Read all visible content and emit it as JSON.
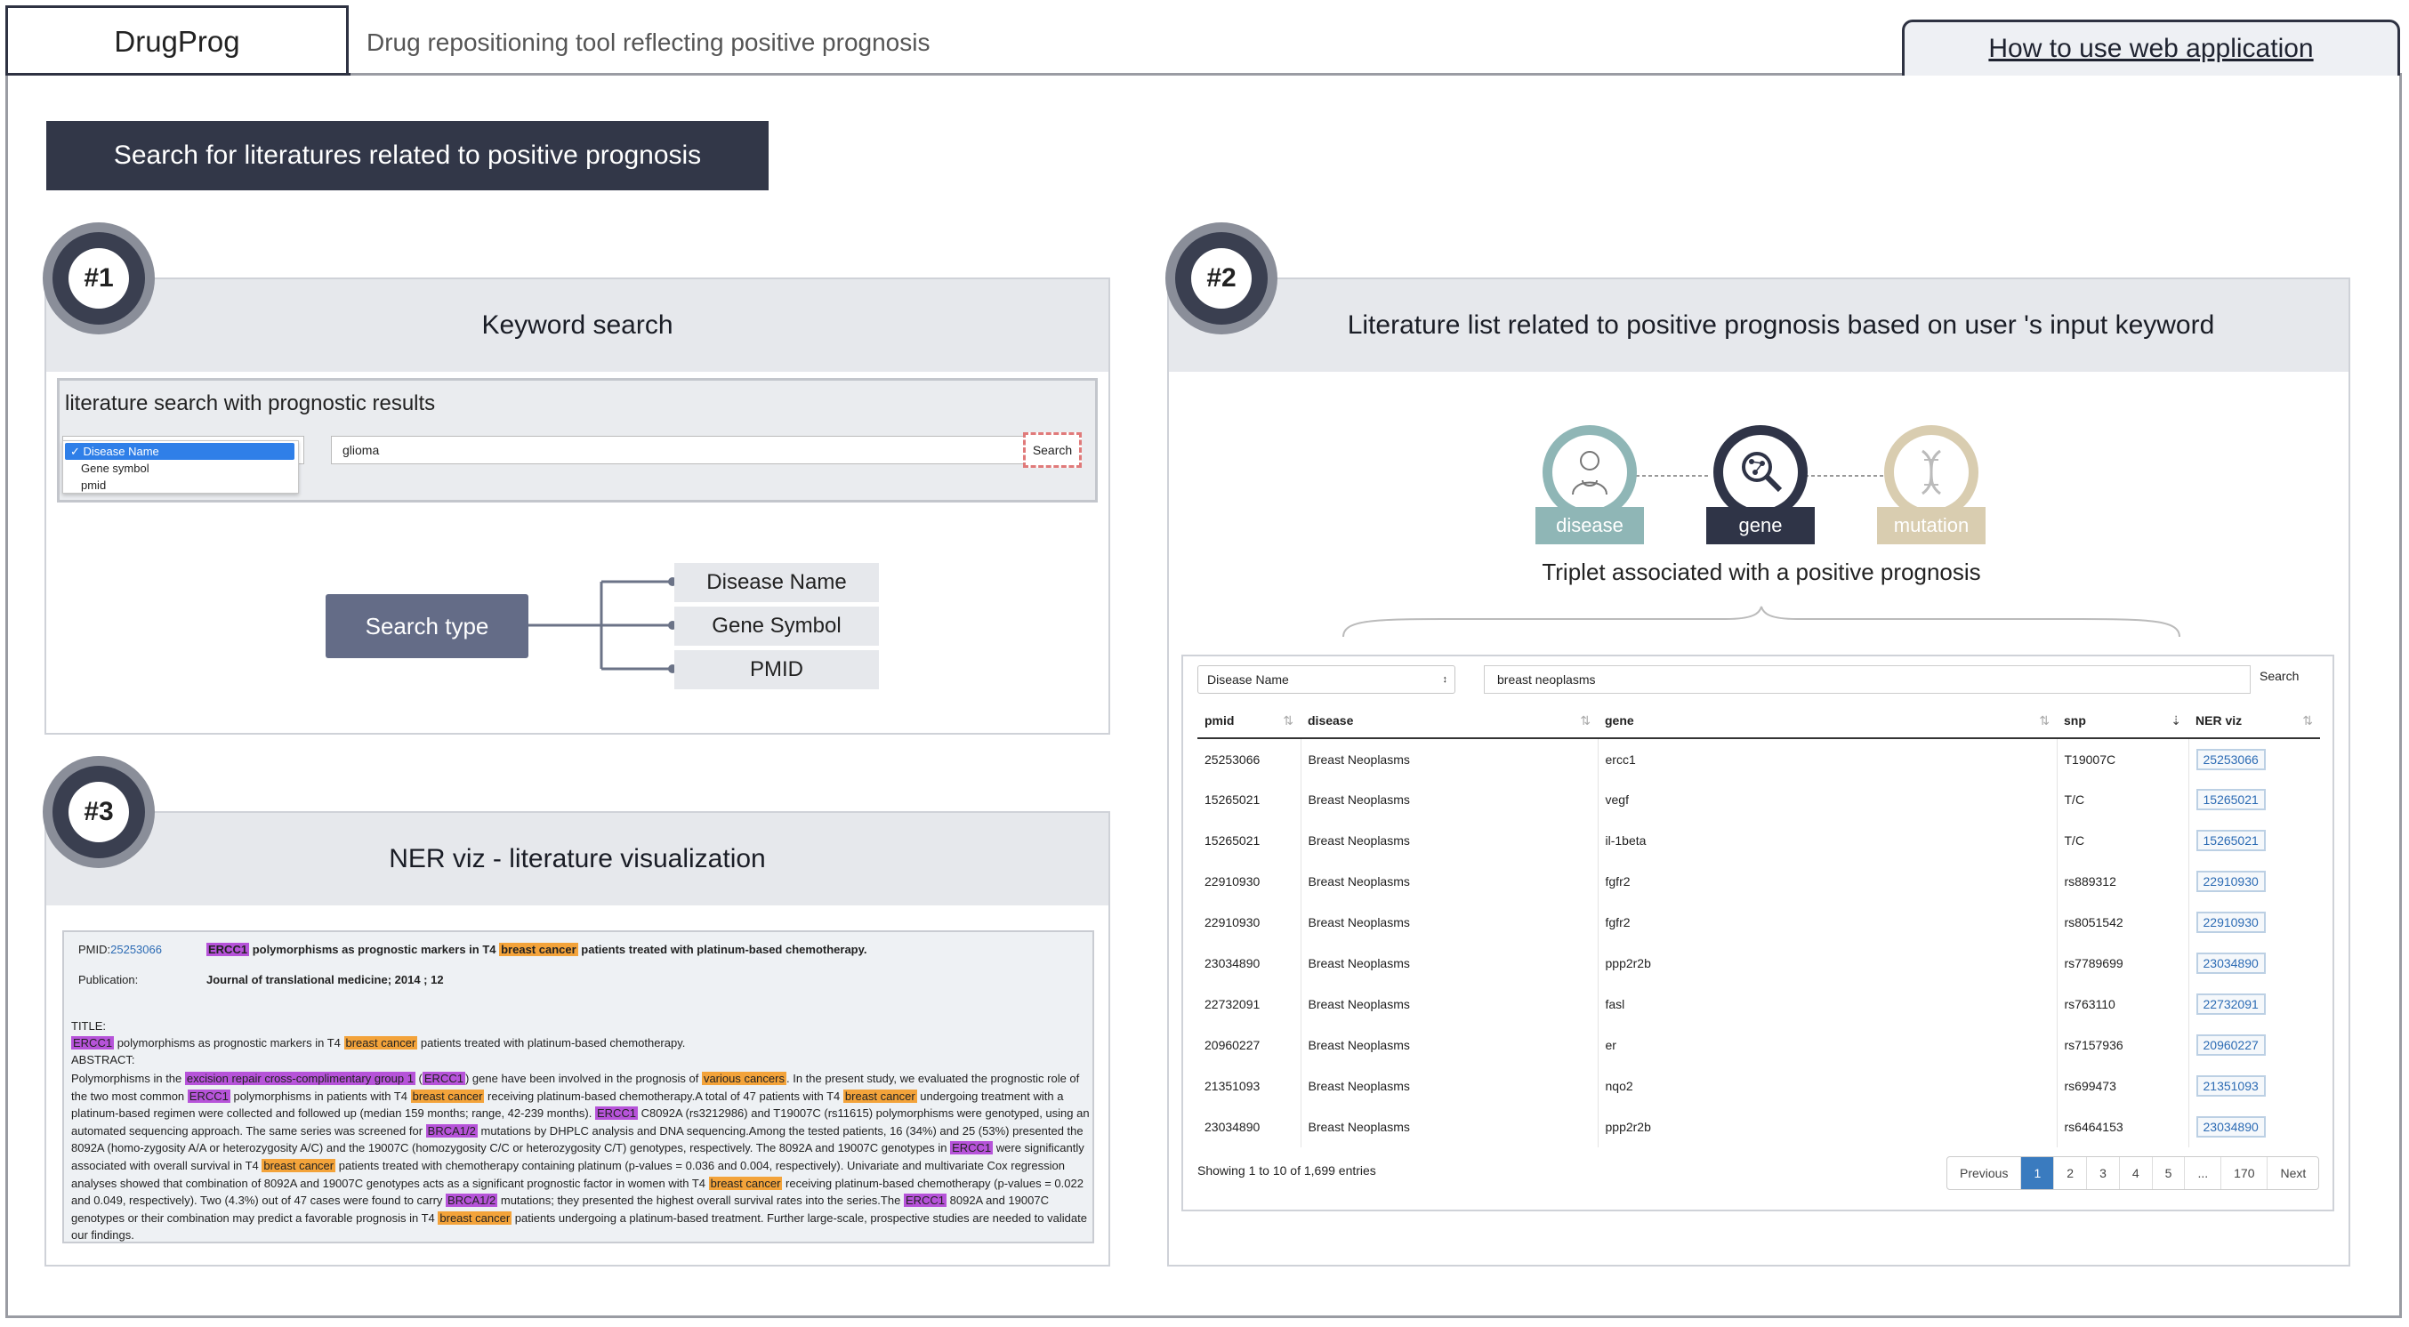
{
  "header": {
    "brand": "DrugProg",
    "tagline": "Drug repositioning tool reflecting positive prognosis",
    "howto_link": "How to use web application"
  },
  "banner": "Search for literatures related to positive prognosis",
  "panel1": {
    "badge": "#1",
    "title": "Keyword search",
    "box_title": "literature search with prognostic results",
    "dropdown_options": [
      "Disease Name",
      "Gene symbol",
      "pmid"
    ],
    "selected_check": "✓",
    "keyword": "glioma",
    "search_label": "Search",
    "search_type_label": "Search type",
    "search_types": [
      "Disease Name",
      "Gene Symbol",
      "PMID"
    ]
  },
  "panel2": {
    "badge": "#2",
    "title": "Literature list related to positive prognosis based on user 's input keyword",
    "triplet": [
      "disease",
      "gene",
      "mutation"
    ],
    "triplet_caption": "Triplet associated with a positive prognosis",
    "filter_select": "Disease Name",
    "filter_value": "breast neoplasms",
    "filter_search": "Search",
    "columns": [
      "pmid",
      "disease",
      "gene",
      "snp",
      "NER viz"
    ],
    "rows": [
      {
        "pmid": "25253066",
        "disease": "Breast Neoplasms",
        "gene": "ercc1",
        "snp": "T19007C",
        "ner": "25253066"
      },
      {
        "pmid": "15265021",
        "disease": "Breast Neoplasms",
        "gene": "vegf",
        "snp": "T/C",
        "ner": "15265021"
      },
      {
        "pmid": "15265021",
        "disease": "Breast Neoplasms",
        "gene": "il-1beta",
        "snp": "T/C",
        "ner": "15265021"
      },
      {
        "pmid": "22910930",
        "disease": "Breast Neoplasms",
        "gene": "fgfr2",
        "snp": "rs889312",
        "ner": "22910930"
      },
      {
        "pmid": "22910930",
        "disease": "Breast Neoplasms",
        "gene": "fgfr2",
        "snp": "rs8051542",
        "ner": "22910930"
      },
      {
        "pmid": "23034890",
        "disease": "Breast Neoplasms",
        "gene": "ppp2r2b",
        "snp": "rs7789699",
        "ner": "23034890"
      },
      {
        "pmid": "22732091",
        "disease": "Breast Neoplasms",
        "gene": "fasl",
        "snp": "rs763110",
        "ner": "22732091"
      },
      {
        "pmid": "20960227",
        "disease": "Breast Neoplasms",
        "gene": "er",
        "snp": "rs7157936",
        "ner": "20960227"
      },
      {
        "pmid": "21351093",
        "disease": "Breast Neoplasms",
        "gene": "nqo2",
        "snp": "rs699473",
        "ner": "21351093"
      },
      {
        "pmid": "23034890",
        "disease": "Breast Neoplasms",
        "gene": "ppp2r2b",
        "snp": "rs6464153",
        "ner": "23034890"
      }
    ],
    "info": "Showing 1 to 10 of 1,699 entries",
    "pager": [
      "Previous",
      "1",
      "2",
      "3",
      "4",
      "5",
      "...",
      "170",
      "Next"
    ]
  },
  "panel3": {
    "badge": "#3",
    "title": "NER viz - literature visualization",
    "pmid_label": "PMID:",
    "pmid_value": "25253066",
    "article_title_gene": "ERCC1",
    "article_title_a": " polymorphisms as prognostic markers in T4 ",
    "article_title_dis": "breast cancer",
    "article_title_b": " patients treated with platinum-based chemotherapy.",
    "publication_label": "Publication:",
    "publication_value": "Journal of translational medicine; 2014 ; 12",
    "title_label": "TITLE:",
    "abstract_label": "ABSTRACT:",
    "t_gene": "ERCC1",
    "t_a": " polymorphisms as prognostic markers in T4 ",
    "t_dis": "breast cancer",
    "t_b": " patients treated with platinum-based chemotherapy.",
    "a1": "Polymorphisms in the ",
    "h1": "excision repair cross-complimentary group 1",
    "a2": " (",
    "h2": "ERCC1",
    "a3": ") gene have been involved in the prognosis of ",
    "h3": "various cancers",
    "a4": ". In the present study, we evaluated the prognostic role of the two most common ",
    "h4": "ERCC1",
    "a5": " polymorphisms in patients with T4 ",
    "h5": "breast cancer",
    "a6": " receiving platinum-based chemotherapy.A total of 47 patients with T4 ",
    "h6": "breast cancer",
    "a7": " undergoing treatment with a platinum-based regimen were collected and followed up (median 159 months; range, 42-239 months). ",
    "h7": "ERCC1",
    "a8": " C8092A (rs3212986) and T19007C (rs11615) polymorphisms were genotyped, using an automated sequencing approach. The same series was screened for ",
    "h8": "BRCA1/2",
    "a9": " mutations by DHPLC analysis and DNA sequencing.Among the tested patients, 16 (34%) and 25 (53%) presented the 8092A (homo-zygosity A/A or heterozygosity A/C) and the 19007C (homozygosity C/C or heterozygosity C/T) genotypes, respectively. The 8092A and 19007C genotypes in ",
    "h9": "ERCC1",
    "a10": " were significantly associated with overall survival in T4 ",
    "h10": "breast cancer",
    "a11": " patients treated with chemotherapy containing platinum (p-values = 0.036 and 0.004, respectively). Univariate and multivariate Cox regression analyses showed that combination of 8092A and 19007C genotypes acts as a significant prognostic factor in women with T4 ",
    "h11": "breast cancer",
    "a12": " receiving platinum-based chemotherapy (p-values = 0.022 and 0.049, respectively). Two (4.3%) out of 47 cases were found to carry ",
    "h12": "BRCA1/2",
    "a13": " mutations; they presented the highest overall survival rates into the series.The ",
    "h13": "ERCC1",
    "a14": " 8092A and 19007C genotypes or their combination may predict a favorable prognosis in T4 ",
    "h14": "breast cancer",
    "a15": " patients undergoing a platinum-based treatment. Further large-scale, prospective studies are needed to validate our findings."
  },
  "colors": {
    "dark": "#323748",
    "accent": "#646c87",
    "highlight_gene": "#b653d9",
    "highlight_disease": "#f3a33a",
    "disease_icon": "#8fb6b6",
    "gene_icon": "#2f3447",
    "mutation_icon": "#d9cdb0"
  }
}
